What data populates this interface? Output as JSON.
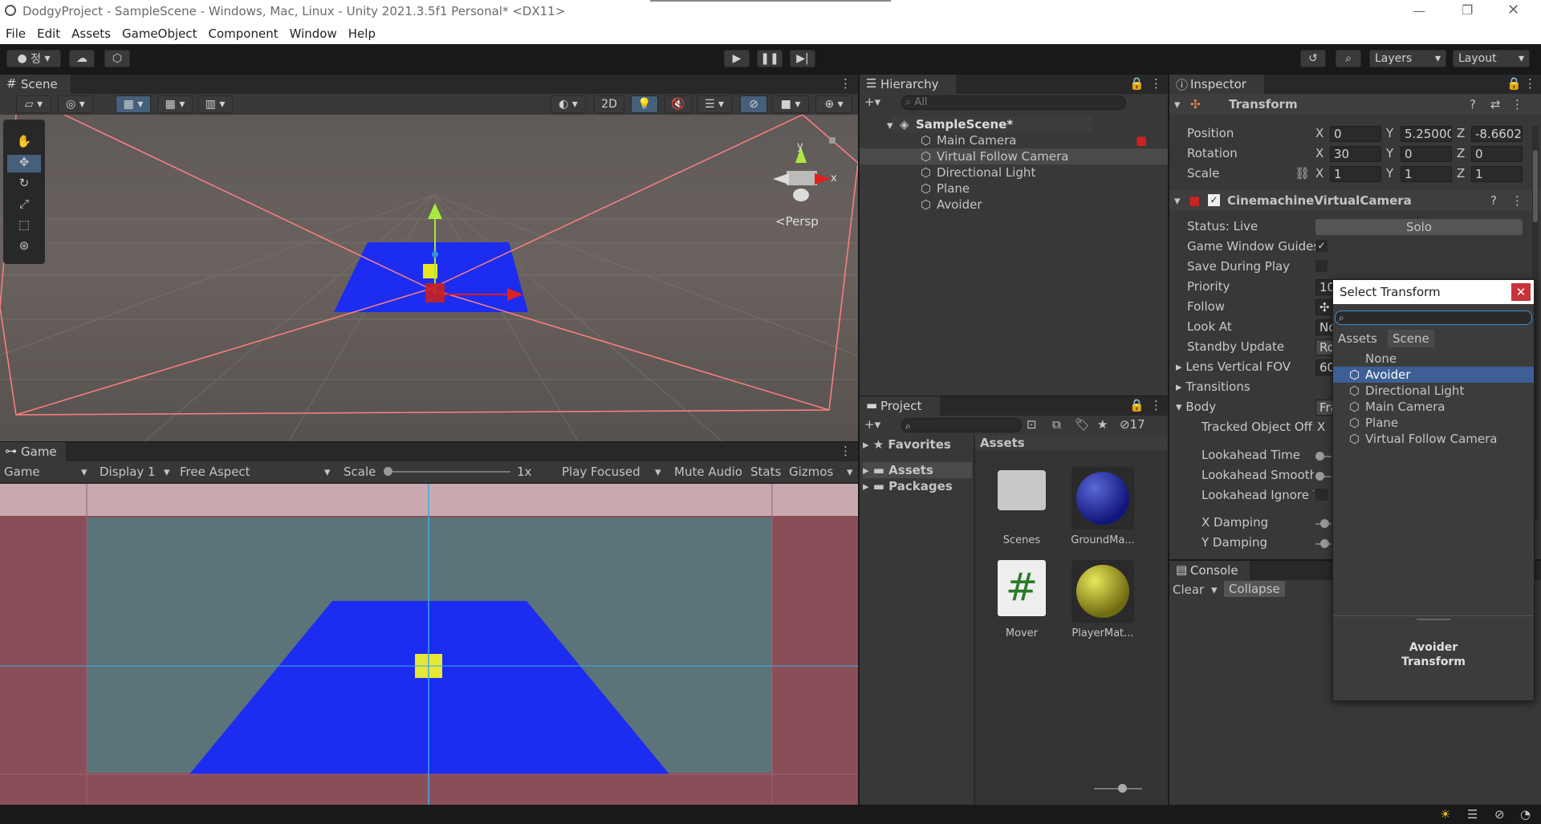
{
  "titlebar": {
    "title": "DodgyProject - SampleScene - Windows, Mac, Linux - Unity 2021.3.5f1 Personal* <DX11>"
  },
  "menu": [
    "File",
    "Edit",
    "Assets",
    "GameObject",
    "Component",
    "Window",
    "Help"
  ],
  "toolbar": {
    "account": "정",
    "layers": "Layers",
    "layout": "Layout"
  },
  "scene": {
    "tab": "Scene",
    "persp": "<Persp",
    "btn2d": "2D",
    "axis_y": "y",
    "axis_x": "x"
  },
  "game": {
    "tab": "Game",
    "view": "Game",
    "display": "Display 1",
    "aspect": "Free Aspect",
    "scale_label": "Scale",
    "scale_value": "1x",
    "play_focused": "Play Focused",
    "mute": "Mute Audio",
    "stats": "Stats",
    "gizmos": "Gizmos"
  },
  "hierarchy": {
    "tab": "Hierarchy",
    "search_placeholder": "All",
    "scene": "SampleScene*",
    "items": [
      "Main Camera",
      "Virtual Follow Camera",
      "Directional Light",
      "Plane",
      "Avoider"
    ]
  },
  "project": {
    "tab": "Project",
    "hidden_count": "17",
    "favorites": "Favorites",
    "assets": "Assets",
    "packages": "Packages",
    "breadcrumb": "Assets",
    "items": [
      "Scenes",
      "GroundMa...",
      "Mover",
      "PlayerMat..."
    ]
  },
  "inspector": {
    "tab": "Inspector",
    "transform": {
      "title": "Transform",
      "position": "Position",
      "rotation": "Rotation",
      "scale": "Scale",
      "pos": [
        "0",
        "5.25000",
        "-8.6602"
      ],
      "rot": [
        "30",
        "0",
        "0"
      ],
      "scl": [
        "1",
        "1",
        "1"
      ]
    },
    "cinemachine": {
      "title": "CinemachineVirtualCamera",
      "status": "Status: Live",
      "solo": "Solo",
      "labels": [
        "Game Window Guides",
        "Save During Play",
        "Priority",
        "Follow",
        "Look At",
        "Standby Update",
        "Lens Vertical FOV",
        "Transitions",
        "Body",
        "Tracked Object Off:",
        "Lookahead Time",
        "Lookahead Smooth",
        "Lookahead Ignore Y",
        "X Damping",
        "Y Damping"
      ],
      "values": {
        "priority": "10",
        "look_at": "No",
        "standby": "Ro",
        "fov": "60",
        "body": "Fra",
        "tracked_x": "X"
      }
    }
  },
  "console": {
    "tab": "Console",
    "clear": "Clear",
    "collapse": "Collapse"
  },
  "popup": {
    "title": "Select Transform",
    "tabs": [
      "Assets",
      "Scene"
    ],
    "items": [
      "None",
      "Avoider",
      "Directional Light",
      "Main Camera",
      "Plane",
      "Virtual Follow Camera"
    ],
    "footer_line1": "Avoider",
    "footer_line2": "Transform"
  },
  "colors": {
    "accent": "#2c5d87",
    "selected": "#3e5f96",
    "plane_blue": "#1c2cf0",
    "panel": "#383838",
    "dark": "#282828"
  }
}
